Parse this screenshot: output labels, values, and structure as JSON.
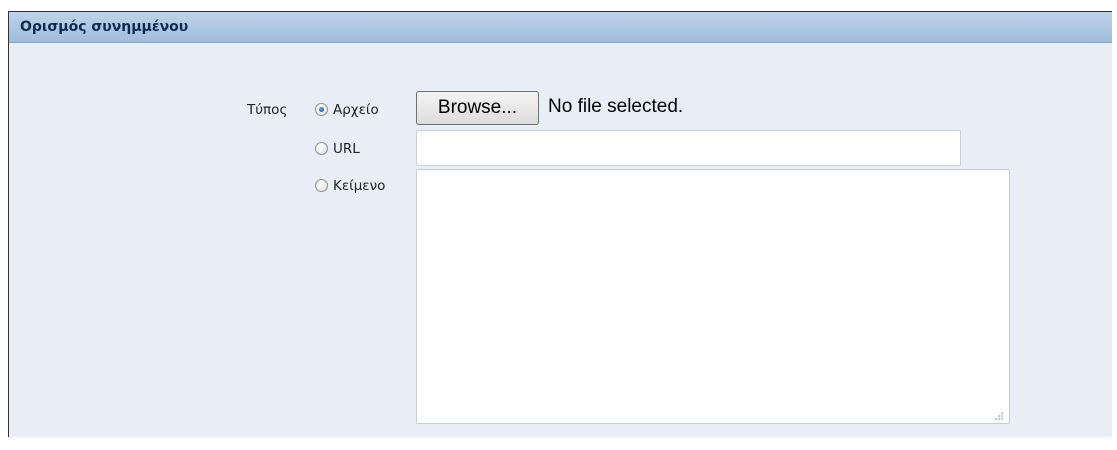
{
  "section": {
    "title": "Ορισμός συνημμένου"
  },
  "type_field": {
    "label": "Τύπος",
    "options": [
      {
        "label": "Αρχείο",
        "checked": true
      },
      {
        "label": "URL",
        "checked": false
      },
      {
        "label": "Κείμενο",
        "checked": false
      }
    ]
  },
  "file_input": {
    "button_label": "Browse...",
    "status": "No file selected."
  },
  "url_input": {
    "value": "",
    "placeholder": ""
  },
  "text_input": {
    "value": ""
  },
  "colors": {
    "panel_bg": "#e9eef6",
    "header_bg": "#afc8e3",
    "title_color": "#0e2b4f"
  }
}
